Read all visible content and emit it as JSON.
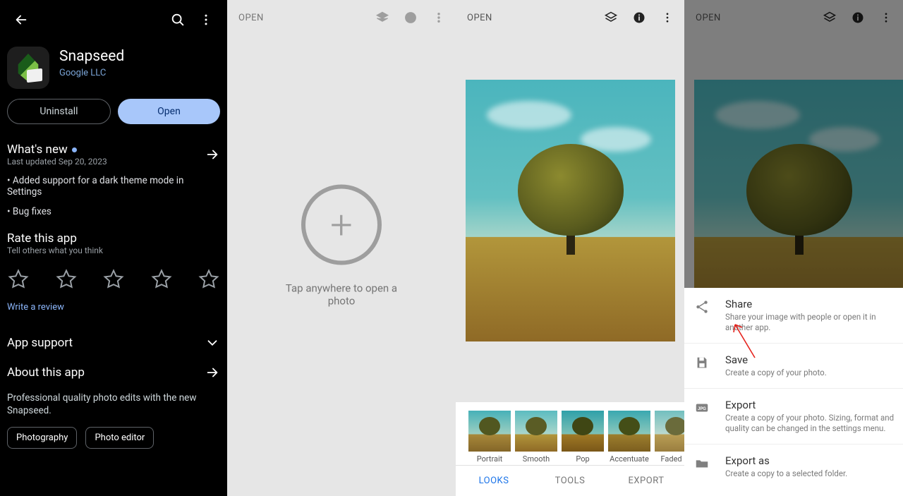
{
  "playstore": {
    "app_name": "Snapseed",
    "developer": "Google LLC",
    "uninstall_label": "Uninstall",
    "open_label": "Open",
    "whats_new_title": "What's new",
    "last_updated": "Last updated Sep 20, 2023",
    "changelog": [
      "• Added support for a dark theme mode in Settings",
      "• Bug fixes"
    ],
    "rate_title": "Rate this app",
    "rate_sub": "Tell others what you think",
    "write_review": "Write a review",
    "app_support": "App support",
    "about_title": "About this app",
    "about_desc": "Professional quality photo edits with the new Snapseed.",
    "chips": [
      "Photography",
      "Photo editor"
    ]
  },
  "snapseed_empty": {
    "open_label": "OPEN",
    "prompt": "Tap anywhere to open a photo"
  },
  "snapseed_photo": {
    "open_label": "OPEN",
    "looks": [
      {
        "label": "Portrait"
      },
      {
        "label": "Smooth"
      },
      {
        "label": "Pop"
      },
      {
        "label": "Accentuate"
      },
      {
        "label": "Faded Gl"
      }
    ],
    "tabs": {
      "looks": "LOOKS",
      "tools": "TOOLS",
      "export": "EXPORT"
    }
  },
  "export_sheet": {
    "open_label": "OPEN",
    "items": [
      {
        "title": "Share",
        "desc": "Share your image with people or open it in another app."
      },
      {
        "title": "Save",
        "desc": "Create a copy of your photo."
      },
      {
        "title": "Export",
        "desc": "Create a copy of your photo. Sizing, format and quality can be changed in the settings menu."
      },
      {
        "title": "Export as",
        "desc": "Create a copy to a selected folder."
      }
    ]
  }
}
